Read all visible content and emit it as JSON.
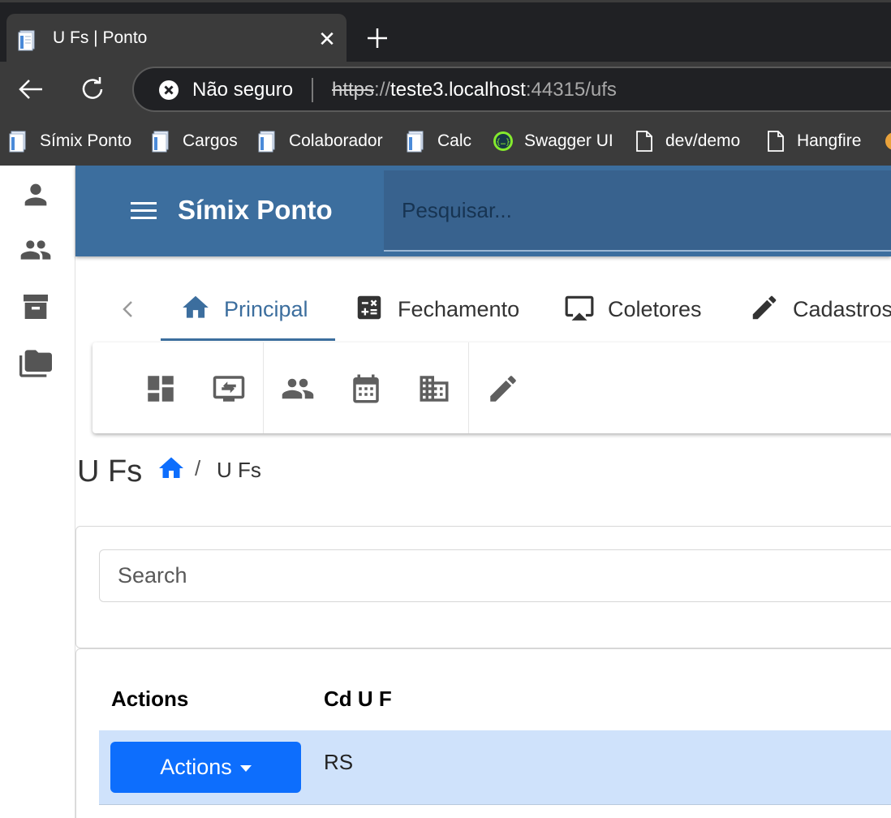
{
  "browser": {
    "tab_title": "U Fs | Ponto",
    "tab_close": "✕",
    "security_label": "Não seguro",
    "url_scheme": "https",
    "url_sep": "://",
    "url_host": "teste3.localhost",
    "url_port_path": ":44315/ufs"
  },
  "bookmarks": [
    {
      "label": "Símix Ponto",
      "icon": "page-blue-icon"
    },
    {
      "label": "Cargos",
      "icon": "page-blue-icon"
    },
    {
      "label": "Colaborador",
      "icon": "page-blue-icon"
    },
    {
      "label": "Calc",
      "icon": "page-blue-icon"
    },
    {
      "label": "Swagger UI",
      "icon": "swagger-icon"
    },
    {
      "label": "dev/demo",
      "icon": "document-icon"
    },
    {
      "label": "Hangfire",
      "icon": "document-icon"
    }
  ],
  "app": {
    "brand": "Símix Ponto",
    "search_placeholder": "Pesquisar...",
    "primary_color": "#3c6e9e"
  },
  "rail": [
    "person-icon",
    "people-icon",
    "archive-icon",
    "folders-icon"
  ],
  "nav_tabs": [
    {
      "label": "Principal",
      "icon": "home-icon",
      "active": true
    },
    {
      "label": "Fechamento",
      "icon": "calculator-icon",
      "active": false
    },
    {
      "label": "Coletores",
      "icon": "airplay-icon",
      "active": false
    },
    {
      "label": "Cadastros",
      "icon": "pencil-icon",
      "active": false
    }
  ],
  "toolbar": [
    "dashboard-icon",
    "monitor-swap-icon",
    "people-icon",
    "calendar-icon",
    "building-icon",
    "pencil-icon"
  ],
  "page": {
    "title": "U Fs",
    "breadcrumb_sep": "/",
    "breadcrumb_current": "U Fs",
    "search_placeholder": "Search"
  },
  "table": {
    "columns": [
      "Actions",
      "Cd U F"
    ],
    "rows": [
      {
        "action_label": "Actions",
        "cd_uf": "RS"
      }
    ],
    "selected_row_color": "#cfe2fb",
    "button_color": "#0d6efd"
  }
}
